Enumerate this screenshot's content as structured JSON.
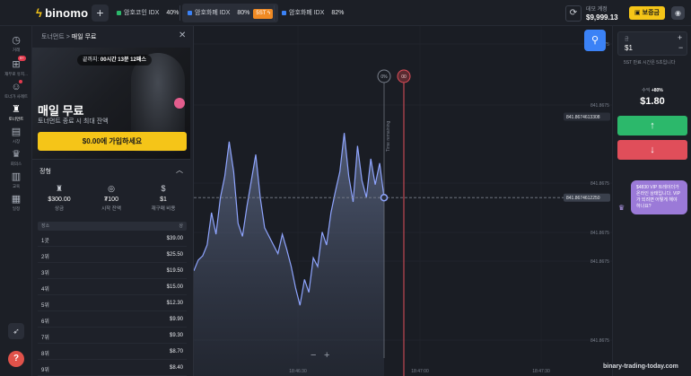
{
  "topbar": {
    "logo": "binomo",
    "add_tab_symbol": "+",
    "tabs": [
      {
        "name": "암호코인 IDX",
        "percent": "40%",
        "color": "#2cb86b",
        "badge": "",
        "active": false
      },
      {
        "name": "암호화폐 IDX",
        "percent": "80%",
        "color": "#3b82f6",
        "badge": "5ST",
        "active": true
      },
      {
        "name": "암호화폐 IDX",
        "percent": "82%",
        "color": "#3b82f6",
        "badge": "",
        "active": false
      }
    ],
    "account_label": "데모 계정",
    "account_balance": "$9,999.13",
    "deposit_label": "보증금"
  },
  "sidebar": {
    "items": [
      {
        "icon": "clock-icon",
        "label": "거래"
      },
      {
        "icon": "gift-icon",
        "label": "재무로 유지..."
      },
      {
        "icon": "people-icon",
        "label": "토너가 사례트"
      },
      {
        "icon": "trophy-icon",
        "label": "토너먼트"
      },
      {
        "icon": "shop-icon",
        "label": "시장"
      },
      {
        "icon": "crown-icon",
        "label": "회의스"
      },
      {
        "icon": "book-icon",
        "label": "교육"
      },
      {
        "icon": "calendar-icon",
        "label": "일정"
      }
    ],
    "badge_text": "9+"
  },
  "panel": {
    "breadcrumb_root": "토너먼트",
    "breadcrumb_sep": ">",
    "breadcrumb_current": "매일 무료",
    "timer_prefix": "끝까지:",
    "timer_value": "00시간 13분 12패스",
    "title": "매일 무료",
    "subtitle": "토너먼트 종료 시 최대 잔액",
    "join_button": "$0.00에 가입하세요",
    "section_title": "정형",
    "stats": [
      {
        "icon": "trophy-icon",
        "value": "$300.00",
        "label": "상금"
      },
      {
        "icon": "coin-icon",
        "value": "₮100",
        "label": "시작 잔액"
      },
      {
        "icon": "dollar-icon",
        "value": "$1",
        "label": "재구매 비용"
      }
    ],
    "table_header": {
      "place": "장소",
      "prize": "상"
    },
    "prizes": [
      {
        "place": "1곳",
        "amount": "$39.00"
      },
      {
        "place": "2위",
        "amount": "$25.50"
      },
      {
        "place": "3위",
        "amount": "$19.50"
      },
      {
        "place": "4위",
        "amount": "$15.00"
      },
      {
        "place": "5위",
        "amount": "$12.30"
      },
      {
        "place": "6위",
        "amount": "$9.90"
      },
      {
        "place": "7위",
        "amount": "$9.30"
      },
      {
        "place": "8위",
        "amount": "$8.70"
      },
      {
        "place": "9위",
        "amount": "$8.40"
      }
    ]
  },
  "chart_data": {
    "type": "area",
    "price_labels": [
      "841.8675",
      "841.8674613308",
      "841.8675",
      "841.8674612250",
      "841.8675",
      "841.8675",
      "841.8675",
      "841.8675"
    ],
    "current_price": "841.8674612250",
    "marker_price": "841.8674613308",
    "time_labels": [
      "18:46:30",
      "18:47:00",
      "18:47:30"
    ],
    "vertical_label": "Time remaining",
    "marker_labels": [
      "0%",
      "00"
    ],
    "series": [
      {
        "values": [
          0.28,
          0.33,
          0.35,
          0.4,
          0.55,
          0.45,
          0.62,
          0.72,
          0.88,
          0.74,
          0.5,
          0.44,
          0.58,
          0.7,
          0.82,
          0.62,
          0.48,
          0.44,
          0.4,
          0.36,
          0.45,
          0.38,
          0.3,
          0.2,
          0.12,
          0.24,
          0.18,
          0.34,
          0.3,
          0.46,
          0.4,
          0.55,
          0.65,
          0.74,
          0.92,
          0.72,
          0.6,
          0.86,
          0.7,
          0.62,
          0.8,
          0.68,
          0.78,
          0.62
        ]
      }
    ],
    "line_color": "#8fa5ff",
    "zoom_out": "−",
    "zoom_in": "+"
  },
  "trade": {
    "amount_label": "금",
    "amount_value": "$1",
    "plus": "+",
    "minus": "−",
    "note": "5ST 만료 시간은 5초입니다",
    "profit_label": "수익",
    "profit_percent": "+80%",
    "profit_value": "$1.80",
    "up_symbol": "↑",
    "down_symbol": "↓",
    "vip_message": "$4830 VIP 트레이더가 온라인 상태입니다. VIP가 되려면 어떻게 해야 하나요?"
  },
  "watermark": "binary-trading-today.com"
}
